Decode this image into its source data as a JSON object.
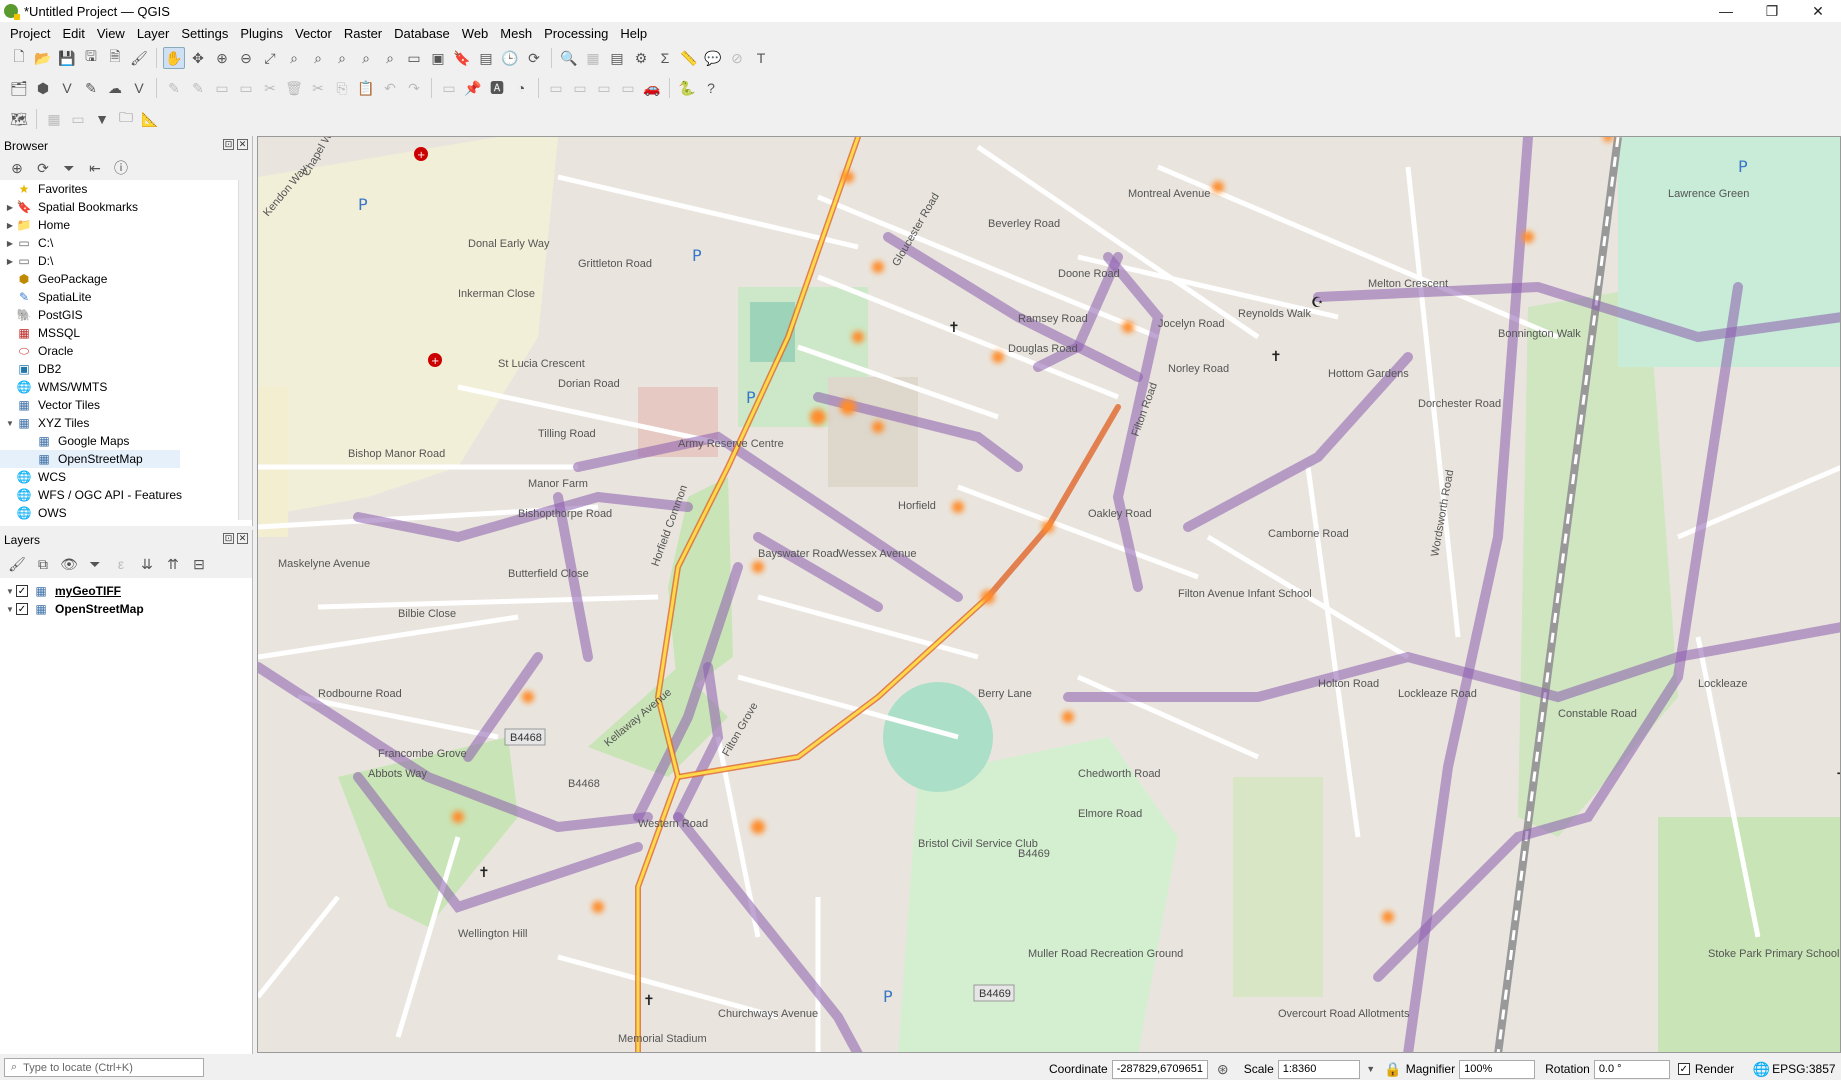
{
  "window": {
    "title": "*Untitled Project — QGIS"
  },
  "menu": [
    "Project",
    "Edit",
    "View",
    "Layer",
    "Settings",
    "Plugins",
    "Vector",
    "Raster",
    "Database",
    "Web",
    "Mesh",
    "Processing",
    "Help"
  ],
  "browser": {
    "title": "Browser",
    "items": [
      {
        "label": "Favorites",
        "icon": "star-icon",
        "arrow": "",
        "indent": 0
      },
      {
        "label": "Spatial Bookmarks",
        "icon": "bookmark-icon",
        "arrow": "▶",
        "indent": 0
      },
      {
        "label": "Home",
        "icon": "folder-icon",
        "arrow": "▶",
        "indent": 0
      },
      {
        "label": "C:\\",
        "icon": "drive-icon",
        "arrow": "▶",
        "indent": 0
      },
      {
        "label": "D:\\",
        "icon": "drive-icon",
        "arrow": "▶",
        "indent": 0
      },
      {
        "label": "GeoPackage",
        "icon": "geopackage-icon",
        "arrow": "",
        "indent": 0
      },
      {
        "label": "SpatiaLite",
        "icon": "spatialite-icon",
        "arrow": "",
        "indent": 0
      },
      {
        "label": "PostGIS",
        "icon": "postgis-icon",
        "arrow": "",
        "indent": 0
      },
      {
        "label": "MSSQL",
        "icon": "mssql-icon",
        "arrow": "",
        "indent": 0
      },
      {
        "label": "Oracle",
        "icon": "oracle-icon",
        "arrow": "",
        "indent": 0
      },
      {
        "label": "DB2",
        "icon": "db2-icon",
        "arrow": "",
        "indent": 0
      },
      {
        "label": "WMS/WMTS",
        "icon": "globe-icon",
        "arrow": "",
        "indent": 0
      },
      {
        "label": "Vector Tiles",
        "icon": "grid-icon",
        "arrow": "",
        "indent": 0
      },
      {
        "label": "XYZ Tiles",
        "icon": "grid-icon",
        "arrow": "▼",
        "indent": 0
      },
      {
        "label": "Google Maps",
        "icon": "grid-icon",
        "arrow": "",
        "indent": 1
      },
      {
        "label": "OpenStreetMap",
        "icon": "grid-icon",
        "arrow": "",
        "indent": 1,
        "selected": true
      },
      {
        "label": "WCS",
        "icon": "globe-icon",
        "arrow": "",
        "indent": 0
      },
      {
        "label": "WFS / OGC API - Features",
        "icon": "globe-icon",
        "arrow": "",
        "indent": 0
      },
      {
        "label": "OWS",
        "icon": "globe-icon",
        "arrow": "",
        "indent": 0
      }
    ]
  },
  "layers": {
    "title": "Layers",
    "items": [
      {
        "label": "myGeoTIFF",
        "checked": true,
        "underline": true
      },
      {
        "label": "OpenStreetMap",
        "checked": true,
        "underline": false
      }
    ]
  },
  "map": {
    "labels": [
      "Chapel Way",
      "Kendon Way",
      "Donal Early Way",
      "Grittleton Road",
      "Montreal Avenue",
      "Inkerman Close",
      "Beverley Road",
      "Doone Road",
      "Ramsey Road",
      "Douglas Road",
      "Jocelyn Road",
      "Norley Road",
      "Reynolds Walk",
      "Melton Crescent",
      "Bonnington Walk",
      "Hottom Gardens",
      "Dorchester Road",
      "St Lucia Crescent",
      "Dorian Road",
      "Tilling Road",
      "Manor Farm",
      "Bishop Manor Road",
      "Army Reserve Centre",
      "Horfield",
      "Bayswater Road",
      "Wessex Avenue",
      "Oakley Road",
      "Filton Avenue Infant School",
      "Lockleaze",
      "Camborne Road",
      "Holton Road",
      "Lockleaze Road",
      "Constable Road",
      "Bishopthorpe Road",
      "Butterfield Close",
      "Bilbie Close",
      "Rodbourne Road",
      "Francombe Grove",
      "Horfield Common",
      "Kellaway Avenue",
      "Abbots Way",
      "B4468",
      "Wellington Hill",
      "Western Road",
      "Filton Grove",
      "Berry Lane",
      "Chedworth Road",
      "Elmore Road",
      "Bristol Civil Service Club",
      "Muller Road Recreation Ground",
      "B4469",
      "Churchways Avenue",
      "Memorial Stadium",
      "Overcourt Road Allotments",
      "Stoke Park Primary School",
      "Maskelyne Avenue",
      "Lawrence Green",
      "Wordsworth Road",
      "Gloucester Road",
      "Filton Road"
    ]
  },
  "status": {
    "locator_placeholder": "Type to locate (Ctrl+K)",
    "coordinate_label": "Coordinate",
    "coordinate_value": "-287829,6709651",
    "scale_label": "Scale",
    "scale_value": "1:8360",
    "magnifier_label": "Magnifier",
    "magnifier_value": "100%",
    "rotation_label": "Rotation",
    "rotation_value": "0.0 °",
    "render_label": "Render",
    "crs": "EPSG:3857"
  }
}
